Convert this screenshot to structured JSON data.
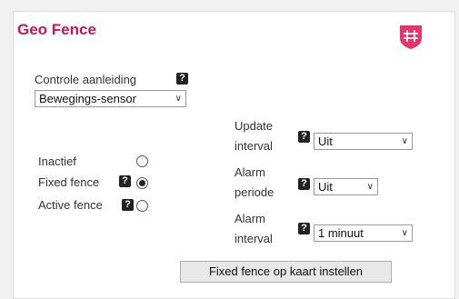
{
  "panel": {
    "title": "Geo Fence",
    "badge_icon": "hashtag-shield-icon",
    "accent_color": "#c2185b",
    "badge_color": "#e8336d"
  },
  "controle": {
    "label": "Controle aanleiding",
    "help": "?",
    "selected": "Bewegings-sensor"
  },
  "fence_modes": [
    {
      "label": "Inactief",
      "selected": false
    },
    {
      "label": "Fixed fence",
      "selected": true,
      "help": "?"
    },
    {
      "label": "Active fence",
      "selected": false,
      "help": "?"
    }
  ],
  "update_interval": {
    "label_line1": "Update",
    "label_line2": "interval",
    "help": "?",
    "selected": "Uit"
  },
  "alarm_periode": {
    "label_line1": "Alarm",
    "label_line2": "periode",
    "help": "?",
    "selected": "Uit"
  },
  "alarm_interval": {
    "label_line1": "Alarm",
    "label_line2": "interval",
    "help": "?",
    "selected": "1 minuut"
  },
  "button": {
    "label": "Fixed fence op kaart instellen"
  }
}
